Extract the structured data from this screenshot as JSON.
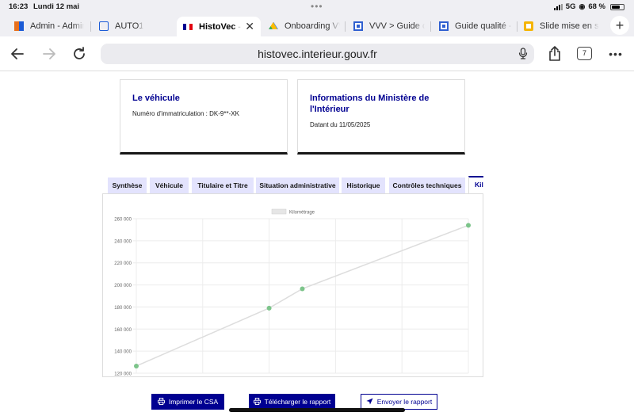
{
  "status_bar": {
    "time": "16:23",
    "date": "Lundi 12 mai",
    "network": "5G",
    "battery": "68 %"
  },
  "browser": {
    "tabs": [
      {
        "title": "Admin - Admin",
        "icon": "grid-logo-icon",
        "color": "#e8711d"
      },
      {
        "title": "AUTO1",
        "icon": "auto1-logo-icon",
        "color": "#1b5bd6"
      },
      {
        "title": "HistoVec -",
        "icon": "french-flag-icon",
        "color": "#000091",
        "active": true
      },
      {
        "title": "Onboarding VV",
        "icon": "google-drive-icon",
        "color": "#34a853"
      },
      {
        "title": "VVV > Guide c",
        "icon": "docs-board-icon",
        "color": "#2f5fd0"
      },
      {
        "title": "Guide qualité -",
        "icon": "docs-board-icon",
        "color": "#2f5fd0"
      },
      {
        "title": "Slide mise en s",
        "icon": "slides-icon",
        "color": "#f5b400"
      }
    ],
    "url": "histovec.interieur.gouv.fr",
    "tab_count": "7"
  },
  "cards": {
    "vehicle": {
      "title": "Le véhicule",
      "text": "Numéro d'immatriculation : DK-9**-XK"
    },
    "ministry": {
      "title": "Informations du Ministère de l'Intérieur",
      "text": "Datant du 11/05/2025"
    }
  },
  "page_tabs": [
    "Synthèse",
    "Véhicule",
    "Titulaire et Titre",
    "Situation administrative",
    "Historique",
    "Contrôles techniques",
    "Kilométrage"
  ],
  "chart_data": {
    "type": "line",
    "legend": "Kilométrage",
    "x": [
      0,
      4,
      5,
      10
    ],
    "y": [
      126500,
      179000,
      196500,
      254000
    ],
    "yticks": [
      "260 000",
      "240 000",
      "220 000",
      "200 000",
      "180 000",
      "160 000",
      "140 000",
      "120 000"
    ],
    "ylim": [
      120000,
      260000
    ],
    "line_color": "#dddddd",
    "point_color": "#7cc48a",
    "grid": true
  },
  "actions": {
    "print": "Imprimer le CSA",
    "download": "Télécharger le rapport",
    "send": "Envoyer le rapport"
  }
}
